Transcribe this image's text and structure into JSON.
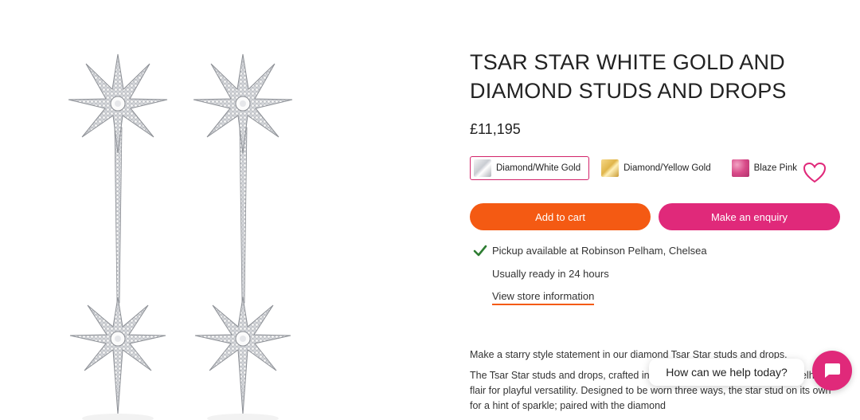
{
  "product": {
    "title_line1": "TSAR STAR WHITE GOLD AND",
    "title_line2": "DIAMOND STUDS AND DROPS",
    "price": "£11,195"
  },
  "variants": [
    {
      "label": "Diamond/White Gold",
      "selected": true,
      "swatch": "white-gold-swatch"
    },
    {
      "label": "Diamond/Yellow Gold",
      "selected": false,
      "swatch": "yellow-gold-swatch"
    },
    {
      "label": "Blaze Pink",
      "selected": false,
      "swatch": "pink-sapphire-swatch"
    }
  ],
  "buttons": {
    "add_to_cart": "Add to cart",
    "enquiry": "Make an enquiry"
  },
  "pickup": {
    "available": "Pickup available at Robinson Pelham, Chelsea",
    "ready": "Usually ready in 24 hours",
    "store_link": "View store information"
  },
  "description": {
    "para1": "Make a starry style statement in our diamond Tsar Star studs and drops.",
    "para2": "The Tsar Star studs and drops, crafted in white gold, showcase Robinson Pelham's flair for playful versatility. Designed to be worn three ways, the star stud on its own for a hint of sparkle; paired with the diamond"
  },
  "chat": {
    "prompt": "How can we help today?"
  },
  "colors": {
    "cart_orange": "#f45a13",
    "enquiry_pink": "#e0297a",
    "selected_border": "#d2236a",
    "check_green": "#2e7d32"
  },
  "icons": {
    "wishlist": "heart-icon",
    "pickup": "check-icon",
    "chat": "chat-icon"
  }
}
